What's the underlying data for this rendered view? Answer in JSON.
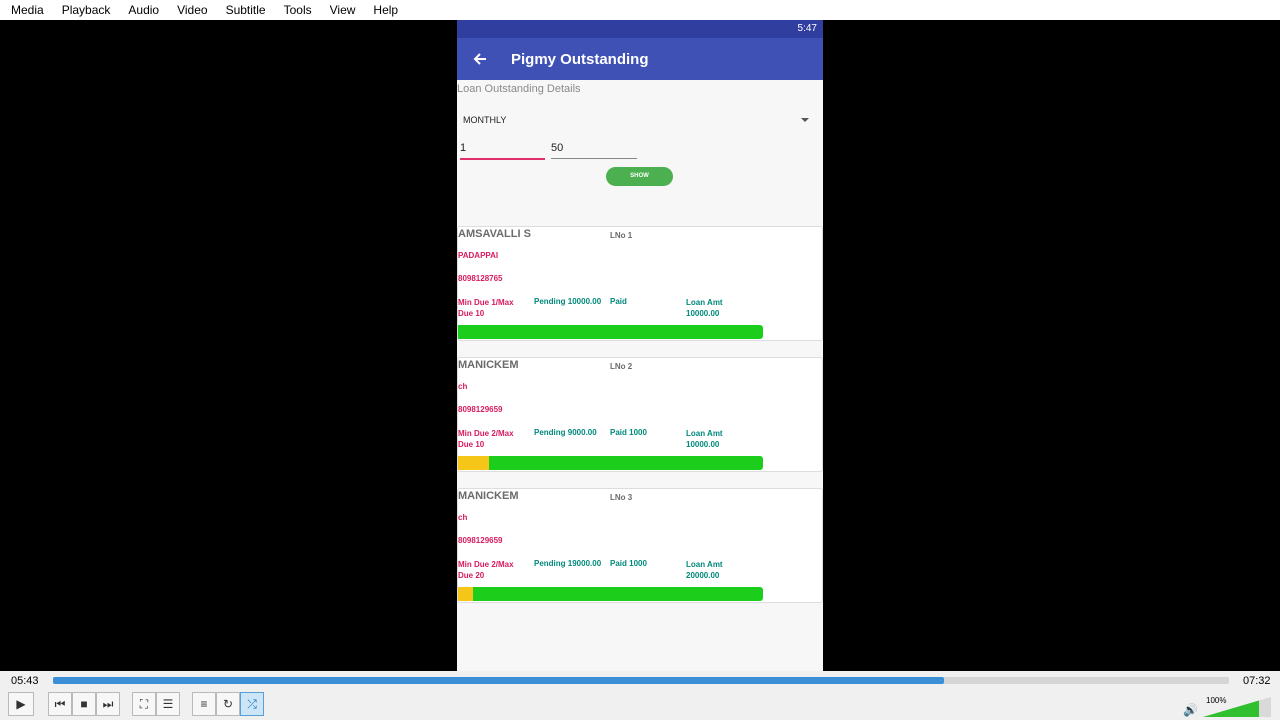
{
  "menu": [
    "Media",
    "Playback",
    "Audio",
    "Video",
    "Subtitle",
    "Tools",
    "View",
    "Help"
  ],
  "phone": {
    "status_time": "5:47",
    "title": "Pigmy Outstanding",
    "section_label": "Loan Outstanding Details",
    "frequency": "MONTHLY",
    "from_value": "1",
    "to_value": "50",
    "show_button": "SHOW",
    "loans": [
      {
        "name": "AMSAVALLI S",
        "lno": "LNo 1",
        "area": "PADAPPAI",
        "phone": "8098128765",
        "due": "Min Due 1/Max Due 10",
        "pending": "Pending 10000.00",
        "paid": "Paid",
        "loan_label": "Loan Amt",
        "loan_amt": "10000.00",
        "paid_fraction": 0
      },
      {
        "name": "MANICKEM",
        "lno": "LNo 2",
        "area": "ch",
        "phone": "8098129659",
        "due": "Min Due 2/Max Due 10",
        "pending": "Pending 9000.00",
        "paid": "Paid 1000",
        "loan_label": "Loan Amt",
        "loan_amt": "10000.00",
        "paid_fraction": 0.1
      },
      {
        "name": "MANICKEM",
        "lno": "LNo 3",
        "area": "ch",
        "phone": "8098129659",
        "due": "Min Due 2/Max Due 20",
        "pending": "Pending 19000.00",
        "paid": "Paid 1000",
        "loan_label": "Loan Amt",
        "loan_amt": "20000.00",
        "paid_fraction": 0.05
      }
    ]
  },
  "player": {
    "current_time": "05:43",
    "total_time": "07:32",
    "progress_fraction": 0.758,
    "volume": "100%"
  },
  "colors": {
    "appbar": "#3f51b5",
    "statusbar": "#303f9f",
    "pink": "#d81b60",
    "teal": "#00897b",
    "bar_green": "#1ccd1c",
    "bar_yellow": "#f5c518",
    "seek_blue": "#3a8fd6"
  }
}
